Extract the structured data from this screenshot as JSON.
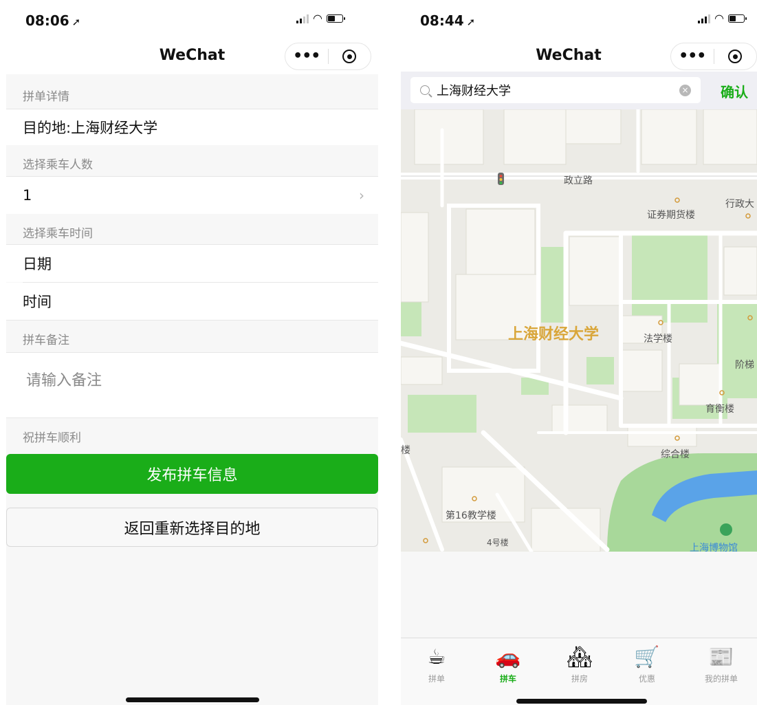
{
  "left": {
    "status": {
      "time": "08:06",
      "arrow": "➚"
    },
    "nav": {
      "title": "WeChat",
      "more": "•••"
    },
    "form": {
      "section_details": "拼单详情",
      "destination": "目的地:上海财经大学",
      "section_people": "选择乘车人数",
      "people_value": "1",
      "chevron": "›",
      "section_time": "选择乘车时间",
      "date_label": "日期",
      "time_label": "时间",
      "section_note": "拼车备注",
      "note_placeholder": "请输入备注",
      "wish": "祝拼车顺利",
      "publish_button": "发布拼车信息",
      "back_button": "返回重新选择目的地"
    }
  },
  "right": {
    "status": {
      "time": "08:44",
      "arrow": "➚"
    },
    "nav": {
      "title": "WeChat",
      "more": "•••"
    },
    "search": {
      "value": "上海财经大学",
      "clear": "×",
      "confirm": "确认"
    },
    "map": {
      "labels": {
        "road": "政立路",
        "securities": "证券期货楼",
        "admin": "行政大",
        "university": "上海财经大学",
        "law": "法学楼",
        "steps": "阶梯",
        "yuheng": "育衡楼",
        "zonghe": "综合楼",
        "building16": "第16教学楼",
        "building4": "4号楼",
        "lou": "楼",
        "museum": "上海",
        "museum2": "博物馆"
      }
    },
    "tabbar": {
      "active_color": "#1aad19",
      "items": [
        {
          "icon": "coffee-icon",
          "glyph": "☕",
          "label": "拼单"
        },
        {
          "icon": "car-icon",
          "glyph": "🚗",
          "label": "拼车"
        },
        {
          "icon": "house-icon",
          "glyph": "🏘",
          "label": "拼房"
        },
        {
          "icon": "cart-icon",
          "glyph": "🛒",
          "label": "优惠"
        },
        {
          "icon": "list-icon",
          "glyph": "📰",
          "label": "我的拼单"
        }
      ]
    }
  }
}
